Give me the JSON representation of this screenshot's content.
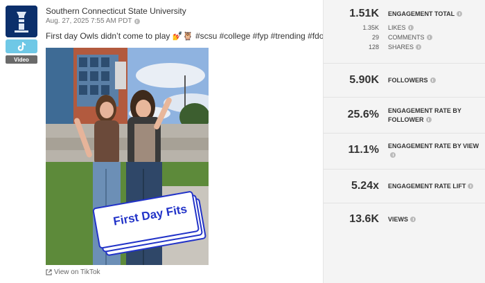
{
  "post": {
    "account_name": "Southern Connecticut State University",
    "date": "Aug. 27, 2025 7:55 AM PDT",
    "caption": "First day Owls didn’t come to play 💅🦉 #scsu #college #fyp #trending #fdoc",
    "platform_tag": "Video",
    "platform_icon": "tiktok-icon",
    "image_overlay_text": "First Day Fits",
    "view_link": "View on TikTok"
  },
  "metrics": {
    "engagement_total": {
      "value": "1.51K",
      "label": "ENGAGEMENT TOTAL"
    },
    "likes": {
      "value": "1.35K",
      "label": "LIKES"
    },
    "comments": {
      "value": "29",
      "label": "COMMENTS"
    },
    "shares": {
      "value": "128",
      "label": "SHARES"
    },
    "followers": {
      "value": "5.90K",
      "label": "FOLLOWERS"
    },
    "er_follower": {
      "value": "25.6%",
      "label": "ENGAGEMENT RATE BY FOLLOWER"
    },
    "er_view": {
      "value": "11.1%",
      "label": "ENGAGEMENT RATE BY VIEW"
    },
    "er_lift": {
      "value": "5.24x",
      "label": "ENGAGEMENT RATE LIFT"
    },
    "views": {
      "value": "13.6K",
      "label": "VIEWS"
    }
  },
  "colors": {
    "avatar_bg": "#0b2f6b",
    "tiktok_badge": "#6fc8e6",
    "panel_bg": "#f4f4f4",
    "sticker_blue": "#2233c8"
  }
}
